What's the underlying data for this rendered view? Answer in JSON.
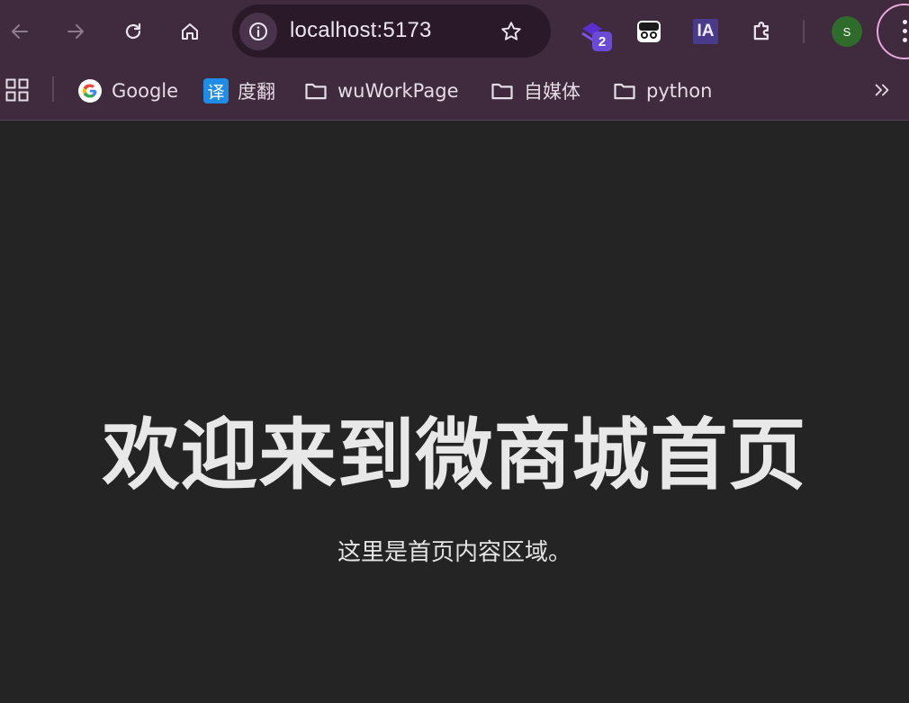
{
  "browser": {
    "url": "localhost:5173",
    "extension_badge": "2",
    "extension_ia_label": "IA",
    "profile_initial": "S",
    "icons": [
      "back-icon",
      "forward-icon",
      "reload-icon",
      "home-icon",
      "info-icon",
      "star-icon",
      "extension-puzzle-icon",
      "more-menu-icon"
    ]
  },
  "bookmarks": [
    {
      "label": "Google",
      "icon": "google-icon"
    },
    {
      "label": "度翻",
      "icon": "translate-icon",
      "icon_text": "译"
    },
    {
      "label": "wuWorkPage",
      "icon": "folder-icon"
    },
    {
      "label": "自媒体",
      "icon": "folder-icon"
    },
    {
      "label": "python",
      "icon": "folder-icon"
    }
  ],
  "page": {
    "heading": "欢迎来到微商城首页",
    "subtext": "这里是首页内容区域。"
  },
  "colors": {
    "toolbar": "#3f2a3e",
    "omnibox": "#2a1a29",
    "page_bg": "#242424",
    "accent_ring": "#e9a8da"
  }
}
